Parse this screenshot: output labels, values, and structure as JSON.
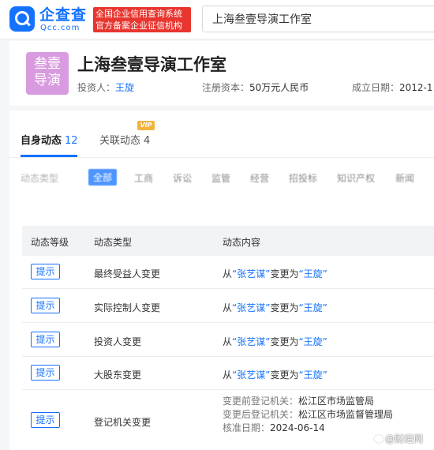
{
  "header": {
    "logo_cn": "企查查",
    "logo_en": "Qcc.com",
    "slogan_line1": "全国企业信用查询系统",
    "slogan_line2": "官方备案企业征信机构",
    "search_value": "上海叁壹导演工作室"
  },
  "company": {
    "avatar_line1": "叁壹",
    "avatar_line2": "导演",
    "name": "上海叁壹导演工作室",
    "investor_label": "投资人：",
    "investor_value": "王旋",
    "capital_label": "注册资本：",
    "capital_value": "50万元人民币",
    "founded_label": "成立日期：",
    "founded_value": "2012-1"
  },
  "tabs": {
    "self_label": "自身动态",
    "self_count": "12",
    "related_label": "关联动态",
    "related_count": "4",
    "vip_badge": "VIP"
  },
  "filter": {
    "label": "动态类型",
    "chips": [
      "全部",
      "工商",
      "诉讼",
      "监管",
      "经营",
      "招投标",
      "知识产权",
      "新闻"
    ]
  },
  "table": {
    "headers": [
      "动态等级",
      "动态类型",
      "动态内容"
    ],
    "rows": [
      {
        "tag": "提示",
        "type": "最终受益人变更",
        "from_prefix": "从",
        "from_value": "“张艺谋”",
        "to_prefix": "变更为",
        "to_value": "“王旋”"
      },
      {
        "tag": "提示",
        "type": "实际控制人变更",
        "from_prefix": "从",
        "from_value": "“张艺谋”",
        "to_prefix": "变更为",
        "to_value": "“王旋”"
      },
      {
        "tag": "提示",
        "type": "投资人变更",
        "from_prefix": "从",
        "from_value": "“张艺谋”",
        "to_prefix": "变更为",
        "to_value": "“王旋”"
      },
      {
        "tag": "提示",
        "type": "大股东变更",
        "from_prefix": "从",
        "from_value": "“张艺谋”",
        "to_prefix": "变更为",
        "to_value": "“王旋”"
      }
    ],
    "last_row": {
      "tag": "提示",
      "type": "登记机关变更",
      "before_label": "变更前登记机关：",
      "before_value": "松江区市场监管局",
      "after_label": "变更后登记机关：",
      "after_value": "松江区市场监督管理局",
      "date_label": "核准日期：",
      "date_value": "2024-06-14"
    }
  },
  "watermark": "@财经网"
}
